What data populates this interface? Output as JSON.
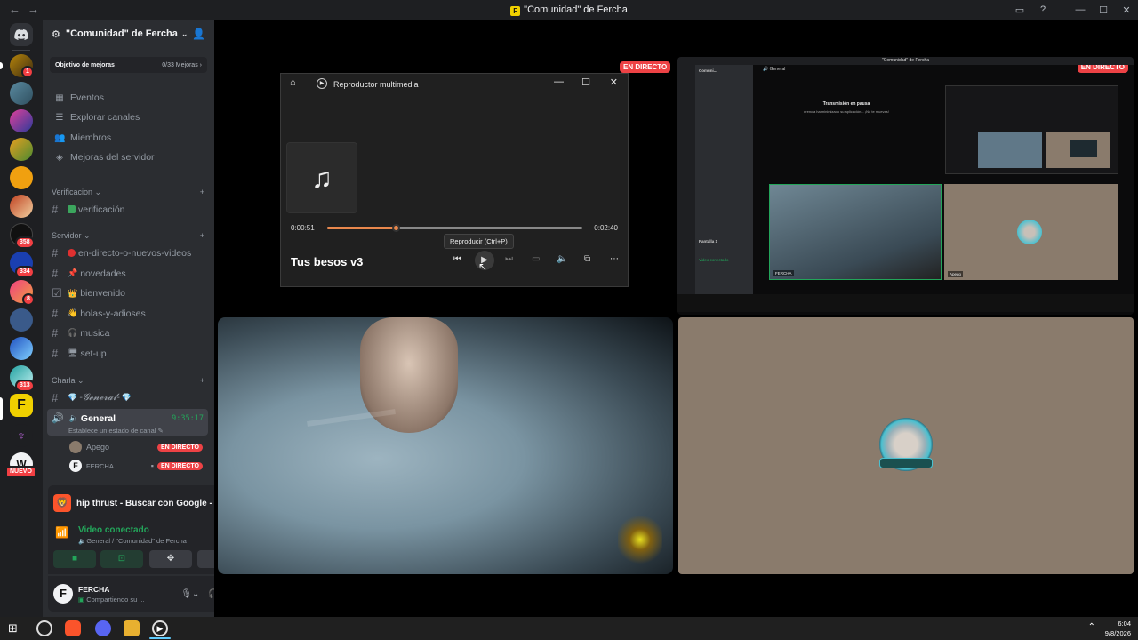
{
  "window": {
    "title": "\"Comunidad\" de Fercha",
    "nav_back": "←",
    "nav_forward": "→"
  },
  "server": {
    "name": "\"Comunidad\" de Fercha",
    "boost_goal": "Objetivo de mejoras",
    "boost_progress": "0/33 Mejoras"
  },
  "menu_items": [
    "Eventos",
    "Explorar canales",
    "Miembros",
    "Mejoras del servidor"
  ],
  "categories": {
    "verificacion": "Verificacion",
    "servidor": "Servidor",
    "charla": "Charla"
  },
  "channels": {
    "verificacion": "verificación",
    "en_directo": "en-directo-o-nuevos-videos",
    "novedades": "novedades",
    "bienvenido": "bienvenido",
    "holas": "holas-y-adioses",
    "musica": "musica",
    "setup": "set-up",
    "general_text": "-𝓖𝓮𝓷𝓮𝓻𝓪𝓵-",
    "general_voice": "General",
    "general_timer": "9:35:17",
    "general_status": "Establece un estado de canal"
  },
  "voice_users": [
    {
      "name": "Apego",
      "live": "EN DIRECTO"
    },
    {
      "name": "FERCHA",
      "live": "EN DIRECTO"
    }
  ],
  "rail_badges": {
    "b1": "1",
    "b358": "358",
    "b334": "334",
    "b8": "8",
    "b313": "313",
    "nuevo": "NUEVO"
  },
  "now_playing": "hip thrust - Buscar con Google - ...",
  "voice_panel": {
    "status": "Video conectado",
    "location": "General / \"Comunidad\" de Fercha"
  },
  "user_panel": {
    "name": "FERCHA",
    "status": "Compartiendo su ..."
  },
  "stream_tags": {
    "left": "EN DIRECTO",
    "right": "EN DIRECTO"
  },
  "player": {
    "app_title": "Reproductor multimedia",
    "elapsed": "0:00:51",
    "total": "0:02:40",
    "progress": 0.27,
    "song": "Tus besos v3",
    "tooltip": "Reproducir (Ctrl+P)"
  },
  "nested_screen": {
    "title": "\"Comunidad\" de Fercha",
    "server_short": "Comuni...",
    "channel": "General",
    "paused_title": "Transmisión en pausa",
    "paused_sub": "erencia ha minimizado su aplicación... ¡No te muevas!",
    "user1": "FERCHA",
    "user2": "Apego",
    "panel": "Pantalla 1",
    "voice": "Video conectado"
  },
  "taskbar": {
    "time": "6:04",
    "date": "9/8/2026"
  },
  "colors": {
    "discord_bg": "#2b2d31",
    "rail_bg": "#1e1f22",
    "live_red": "#ed4245",
    "accent_green": "#23a55a",
    "progress_orange": "#e8874c",
    "hoodie_blue": "#8ea6b3",
    "stream_tan": "#8a7b6c"
  }
}
